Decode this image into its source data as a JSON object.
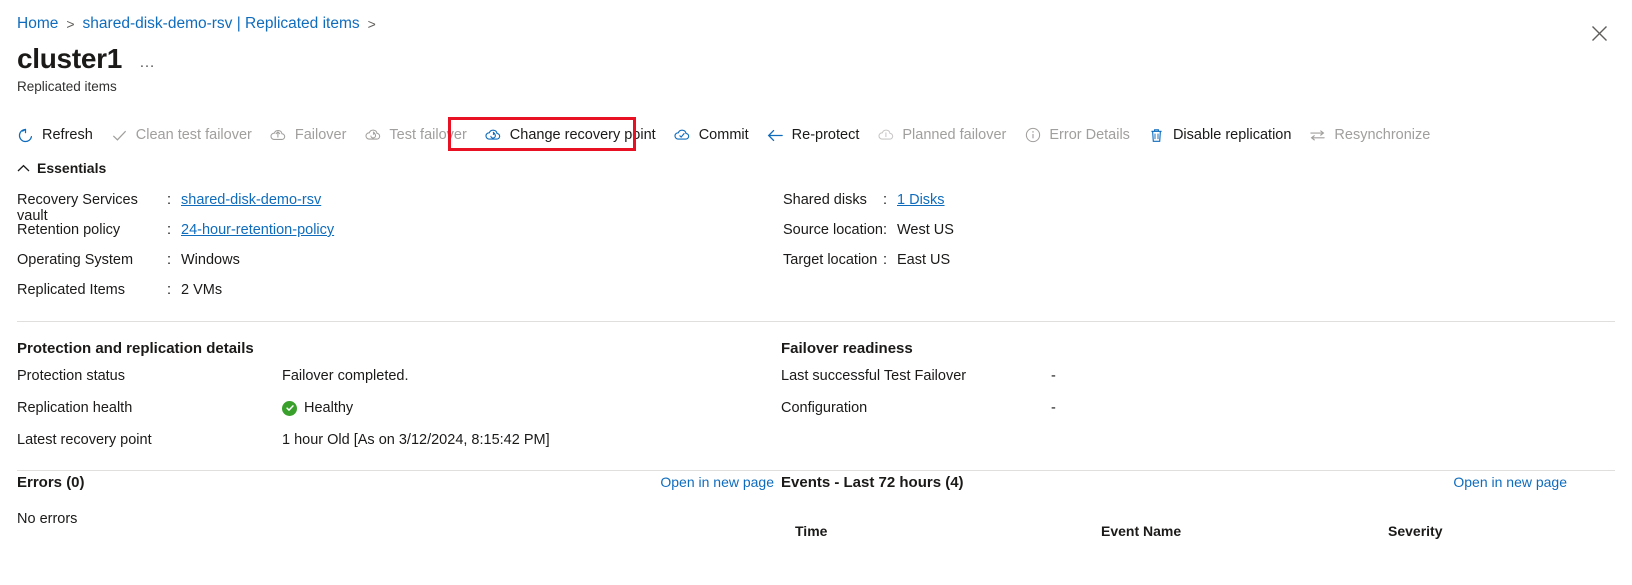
{
  "breadcrumb": {
    "items": [
      {
        "label": "Home",
        "link": true
      },
      {
        "label": "shared-disk-demo-rsv | Replicated items",
        "link": true
      }
    ],
    "separator": ">"
  },
  "header": {
    "title": "cluster1",
    "ellipsis": "…",
    "subtitle": "Replicated items",
    "close_label": "Close"
  },
  "toolbar": {
    "highlight_color": "#e81123",
    "items": [
      {
        "label": "Refresh",
        "icon": "refresh-icon",
        "disabled": false
      },
      {
        "label": "Clean test failover",
        "icon": "checkmark-icon",
        "disabled": true
      },
      {
        "label": "Failover",
        "icon": "cloud-arrow-icon",
        "disabled": true
      },
      {
        "label": "Test failover",
        "icon": "cloud-sync-icon",
        "disabled": true
      },
      {
        "label": "Change recovery point",
        "icon": "cloud-sync-icon",
        "disabled": false,
        "highlighted": true
      },
      {
        "label": "Commit",
        "icon": "cloud-check-icon",
        "disabled": false
      },
      {
        "label": "Re-protect",
        "icon": "arrow-left-icon",
        "disabled": false
      },
      {
        "label": "Planned failover",
        "icon": "cloud-arrow-icon",
        "disabled": true
      },
      {
        "label": "Error Details",
        "icon": "info-circle-icon",
        "disabled": true
      },
      {
        "label": "Disable replication",
        "icon": "trash-icon",
        "disabled": false
      },
      {
        "label": "Resynchronize",
        "icon": "two-arrows-icon",
        "disabled": true
      }
    ]
  },
  "essentials": {
    "header": "Essentials",
    "expanded": true,
    "left": [
      {
        "label": "Recovery Services vault",
        "value": "shared-disk-demo-rsv",
        "link": true
      },
      {
        "label": "Retention policy",
        "value": "24-hour-retention-policy",
        "link": true
      },
      {
        "label": "Operating System",
        "value": "Windows",
        "link": false
      },
      {
        "label": "Replicated Items",
        "value": "2 VMs",
        "link": false
      }
    ],
    "right": [
      {
        "label": "Shared disks",
        "value": "1 Disks",
        "link": true
      },
      {
        "label": "Source location",
        "value": "West US",
        "link": false
      },
      {
        "label": "Target location",
        "value": "East US",
        "link": false
      }
    ]
  },
  "protection": {
    "title": "Protection and replication details",
    "rows": [
      {
        "key": "Protection status",
        "value": "Failover completed.",
        "badge": null
      },
      {
        "key": "Replication health",
        "value": "Healthy",
        "badge": "healthy-check-icon"
      },
      {
        "key": "Latest recovery point",
        "value": "1 hour Old [As on 3/12/2024, 8:15:42 PM]",
        "badge": null
      }
    ]
  },
  "failover_readiness": {
    "title": "Failover readiness",
    "rows": [
      {
        "key": "Last successful Test Failover",
        "value": "-"
      },
      {
        "key": "Configuration",
        "value": "-"
      }
    ]
  },
  "errors_panel": {
    "title": "Errors (0)",
    "link": "Open in new page",
    "body": "No errors"
  },
  "events_panel": {
    "title": "Events - Last 72 hours (4)",
    "link": "Open in new page",
    "columns": [
      "Time",
      "Event Name",
      "Severity"
    ]
  },
  "colors": {
    "accent_link": "#0f6cbd",
    "healthy_green": "#3aa02c",
    "highlight_red": "#e81123",
    "disabled_gray": "#a19f9d"
  }
}
